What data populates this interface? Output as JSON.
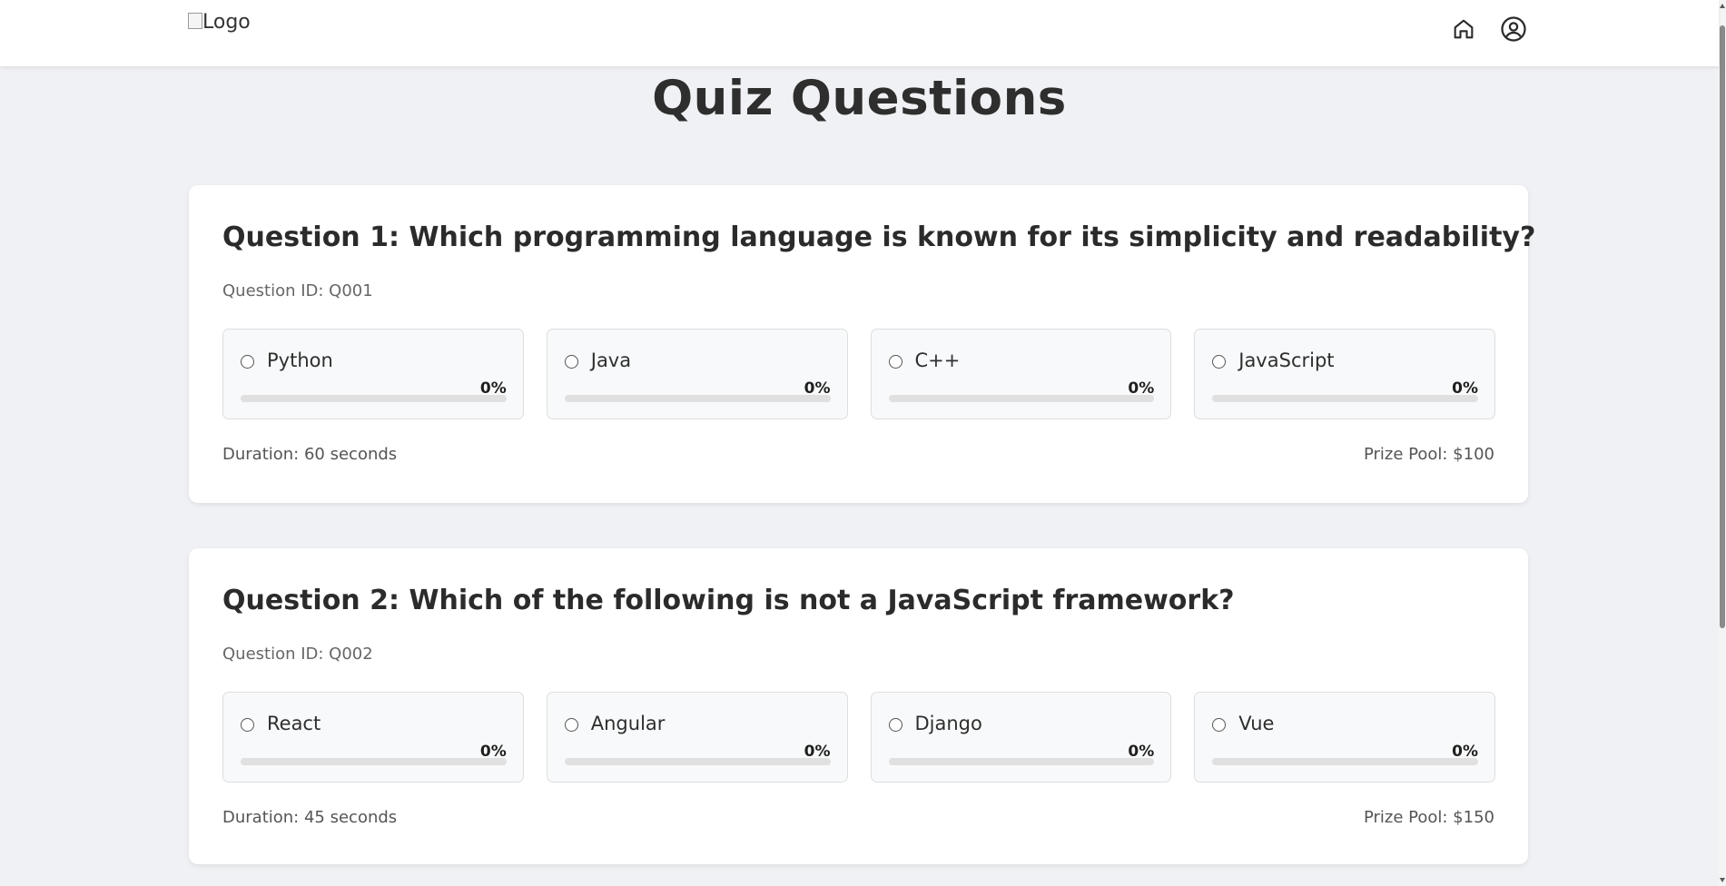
{
  "header": {
    "logo_alt": "Logo",
    "home_icon": "home-icon",
    "profile_icon": "user-circle-icon"
  },
  "page_title": "Quiz Questions",
  "colors": {
    "background": "#f0f1f4",
    "card": "#ffffff",
    "option_bg": "#f8f9fa",
    "bar_track": "#e0e0e0"
  },
  "questions": [
    {
      "title": "Question 1: Which programming language is known for its simplicity and readability?",
      "id_text": "Question ID: Q001",
      "options": [
        {
          "label": "Python",
          "percent": "0%",
          "fill": 0
        },
        {
          "label": "Java",
          "percent": "0%",
          "fill": 0
        },
        {
          "label": "C++",
          "percent": "0%",
          "fill": 0
        },
        {
          "label": "JavaScript",
          "percent": "0%",
          "fill": 0
        }
      ],
      "duration": "Duration: 60 seconds",
      "prize": "Prize Pool: $100"
    },
    {
      "title": "Question 2: Which of the following is not a JavaScript framework?",
      "id_text": "Question ID: Q002",
      "options": [
        {
          "label": "React",
          "percent": "0%",
          "fill": 0
        },
        {
          "label": "Angular",
          "percent": "0%",
          "fill": 0
        },
        {
          "label": "Django",
          "percent": "0%",
          "fill": 0
        },
        {
          "label": "Vue",
          "percent": "0%",
          "fill": 0
        }
      ],
      "duration": "Duration: 45 seconds",
      "prize": "Prize Pool: $150"
    }
  ]
}
